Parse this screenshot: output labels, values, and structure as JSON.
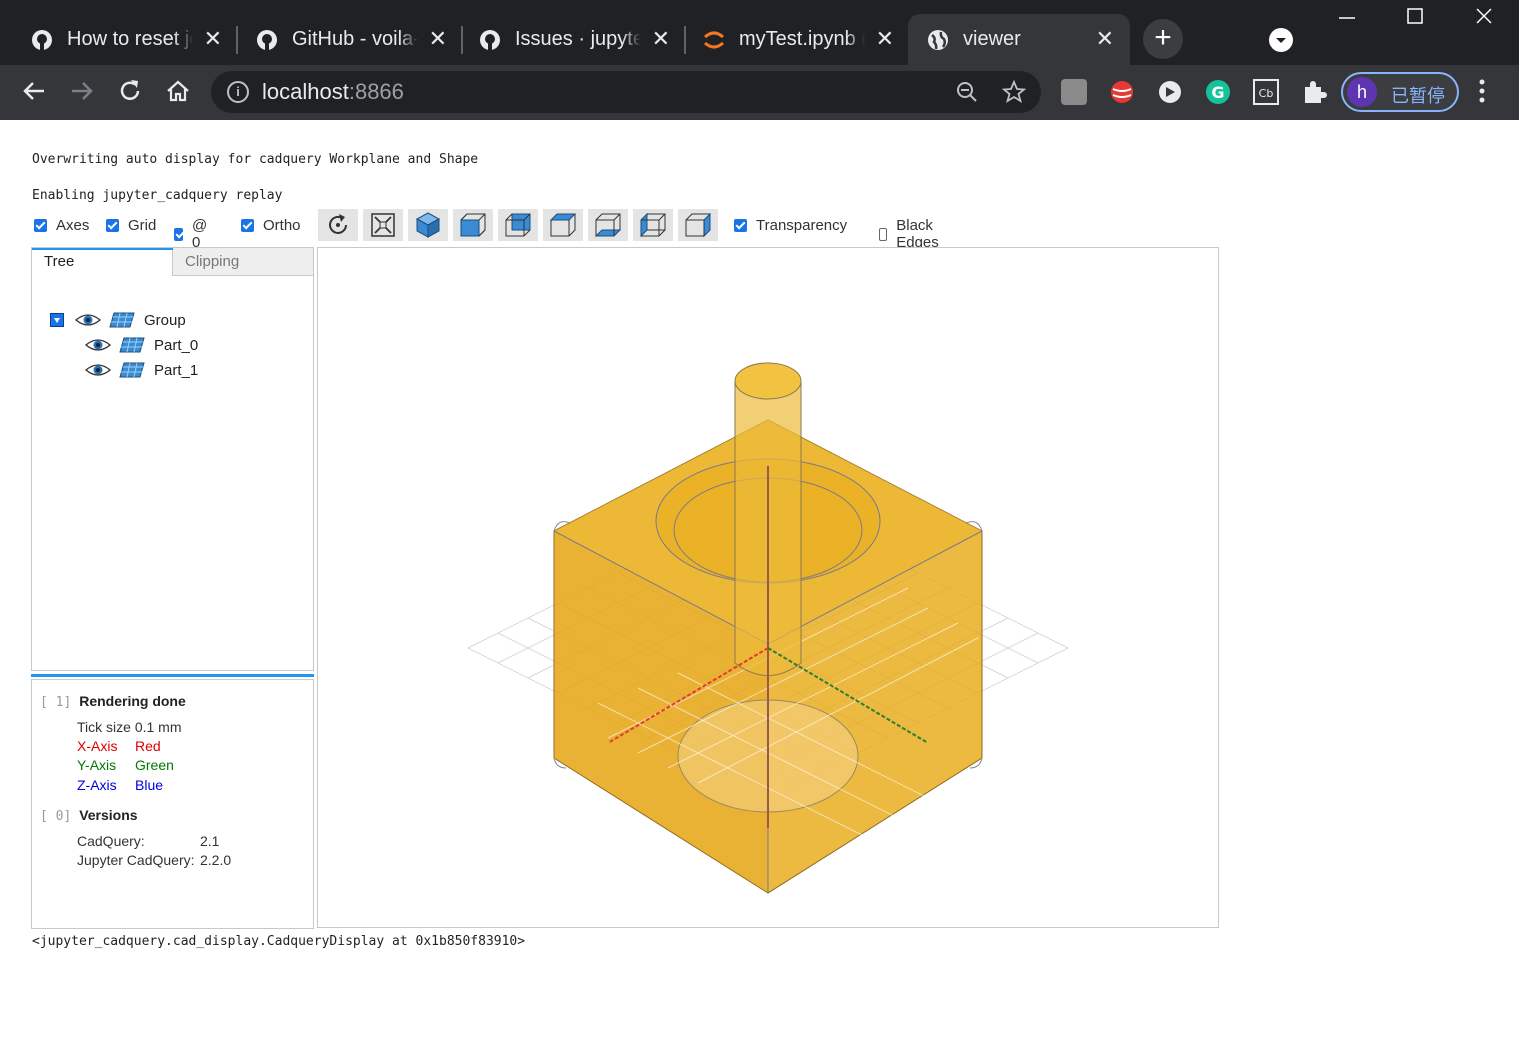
{
  "browser": {
    "tabs": [
      {
        "title": "How to reset jo",
        "icon": "github-icon"
      },
      {
        "title": "GitHub - voila-",
        "icon": "github-icon"
      },
      {
        "title": "Issues · jupyter",
        "icon": "github-icon"
      },
      {
        "title": "myTest.ipynb (",
        "icon": "jupyter-icon"
      },
      {
        "title": "viewer",
        "icon": "globe-icon"
      }
    ],
    "close_glyph": "✕",
    "new_tab_glyph": "+",
    "url_host": "localhost",
    "url_port": ":8866",
    "profile_initial": "h",
    "profile_label": "已暂停"
  },
  "output": {
    "line1": "Overwriting auto display for cadquery Workplane and Shape",
    "line2": "Enabling jupyter_cadquery replay",
    "footer": "<jupyter_cadquery.cad_display.CadqueryDisplay at 0x1b850f83910>"
  },
  "controls": {
    "checkboxes": [
      {
        "label": "Axes",
        "checked": true
      },
      {
        "label": "Grid",
        "checked": true
      },
      {
        "label": "@ 0",
        "checked": true
      },
      {
        "label": "Ortho",
        "checked": true
      }
    ],
    "view_buttons": [
      "reset-view",
      "fit",
      "iso",
      "front",
      "rear",
      "top",
      "bottom",
      "left",
      "right"
    ],
    "transparency": {
      "label": "Transparency",
      "checked": true
    },
    "black_edges": {
      "label": "Black Edges",
      "checked": false
    }
  },
  "panel": {
    "tab_tree": "Tree",
    "tab_clipping": "Clipping",
    "tree": {
      "group": "Group",
      "parts": [
        "Part_0",
        "Part_1"
      ]
    }
  },
  "log": {
    "entry1": {
      "index": "[ 1]",
      "title": "Rendering done",
      "tick": "Tick size 0.1 mm",
      "axes": [
        {
          "axis": "X-Axis",
          "color_name": "Red",
          "color": "#e00000"
        },
        {
          "axis": "Y-Axis",
          "color_name": "Green",
          "color": "#007a00"
        },
        {
          "axis": "Z-Axis",
          "color_name": "Blue",
          "color": "#0000e0"
        }
      ]
    },
    "entry0": {
      "index": "[ 0]",
      "title": "Versions",
      "rows": [
        {
          "k": "CadQuery:",
          "v": "2.1"
        },
        {
          "k": "Jupyter CadQuery:",
          "v": "2.2.0"
        }
      ]
    }
  },
  "colors": {
    "accent": "#2196f3",
    "part": "#e8a917"
  }
}
